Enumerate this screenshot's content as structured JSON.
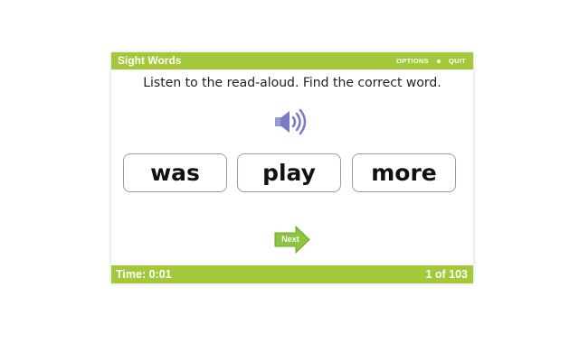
{
  "header": {
    "title": "Sight Words",
    "options_label": "OPTIONS",
    "quit_label": "QUIT"
  },
  "question": {
    "instruction": "Listen to the read-aloud. Find the correct word.",
    "audio_icon": "speaker-icon"
  },
  "choices": [
    {
      "label": "was"
    },
    {
      "label": "play"
    },
    {
      "label": "more"
    }
  ],
  "next": {
    "label": "Next",
    "icon": "arrow-right-icon"
  },
  "footer": {
    "time_label": "Time:",
    "time_value": "0:01",
    "progress": "1 of 103"
  },
  "colors": {
    "brand_green": "#a3c93a",
    "speaker_purple": "#7b7bc4",
    "next_green": "#8cc63f"
  }
}
